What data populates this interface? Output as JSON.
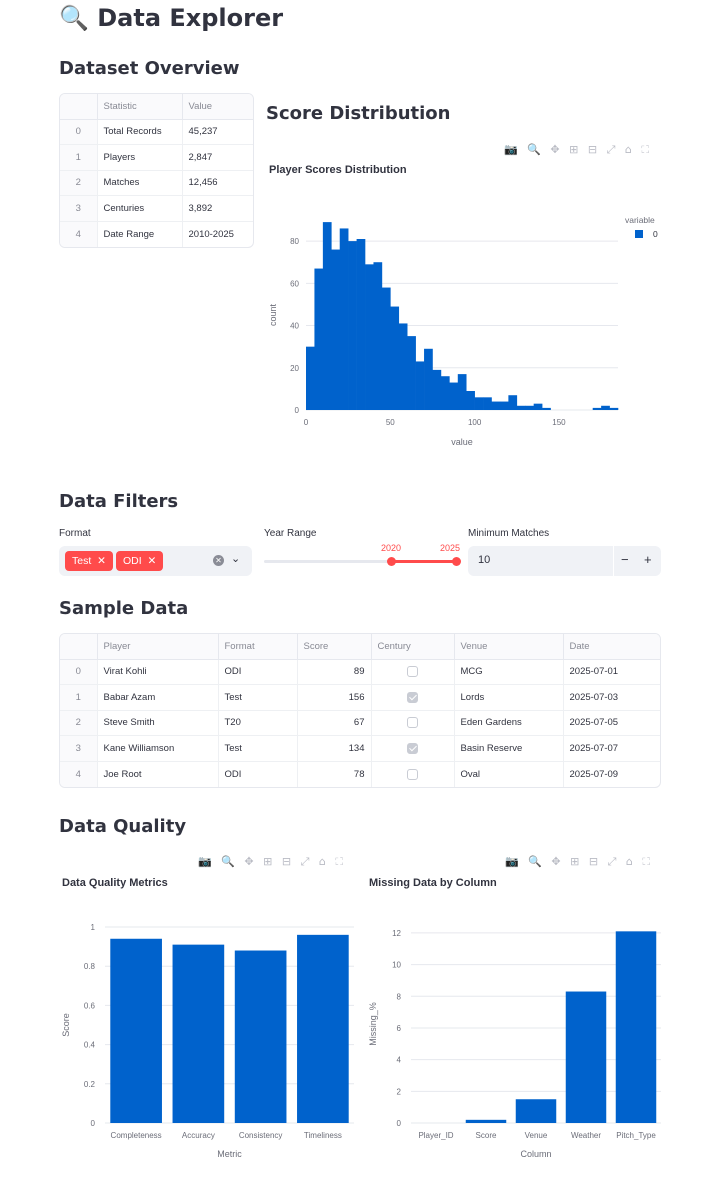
{
  "page": {
    "title": "🔍 Data Explorer",
    "overview_heading": "Dataset Overview",
    "score_heading": "Score Distribution",
    "filters_heading": "Data Filters",
    "sample_heading": "Sample Data",
    "quality_heading": "Data Quality"
  },
  "overview_table": {
    "headers": [
      "",
      "Statistic",
      "Value"
    ],
    "rows": [
      {
        "index": "0",
        "stat": "Total Records",
        "value": "45,237"
      },
      {
        "index": "1",
        "stat": "Players",
        "value": "2,847"
      },
      {
        "index": "2",
        "stat": "Matches",
        "value": "12,456"
      },
      {
        "index": "3",
        "stat": "Centuries",
        "value": "3,892"
      },
      {
        "index": "4",
        "stat": "Date Range",
        "value": "2010-2025"
      }
    ]
  },
  "filters": {
    "format_label": "Format",
    "format_tags": [
      "Test",
      "ODI"
    ],
    "year_label": "Year Range",
    "year_min": "2020",
    "year_max": "2025",
    "matches_label": "Minimum Matches",
    "matches_value": "10",
    "accent": "#ff4b4b"
  },
  "sample_table": {
    "headers": [
      "",
      "Player",
      "Format",
      "Score",
      "Century",
      "Venue",
      "Date"
    ],
    "rows": [
      {
        "index": "0",
        "player": "Virat Kohli",
        "format": "ODI",
        "score": "89",
        "century": false,
        "venue": "MCG",
        "date": "2025-07-01"
      },
      {
        "index": "1",
        "player": "Babar Azam",
        "format": "Test",
        "score": "156",
        "century": true,
        "venue": "Lords",
        "date": "2025-07-03"
      },
      {
        "index": "2",
        "player": "Steve Smith",
        "format": "T20",
        "score": "67",
        "century": false,
        "venue": "Eden Gardens",
        "date": "2025-07-05"
      },
      {
        "index": "3",
        "player": "Kane Williamson",
        "format": "Test",
        "score": "134",
        "century": true,
        "venue": "Basin Reserve",
        "date": "2025-07-07"
      },
      {
        "index": "4",
        "player": "Joe Root",
        "format": "ODI",
        "score": "78",
        "century": false,
        "venue": "Oval",
        "date": "2025-07-09"
      }
    ]
  },
  "toolbar_icons": [
    "camera-icon",
    "zoom-icon",
    "pan-icon",
    "zoom-in-icon",
    "zoom-out-icon",
    "autoscale-icon",
    "home-icon",
    "fullscreen-icon"
  ],
  "chart_data": [
    {
      "type": "bar",
      "title": "Player Scores Distribution",
      "xlabel": "value",
      "ylabel": "count",
      "legend_title": "variable",
      "xlim": [
        0,
        185
      ],
      "ylim": [
        0,
        90
      ],
      "xticks": [
        0,
        50,
        100,
        150
      ],
      "yticks": [
        0,
        20,
        40,
        60,
        80
      ],
      "bin_width": 5,
      "series": [
        {
          "name": "0",
          "color": "#0062cc",
          "x": [
            2.5,
            7.5,
            12.5,
            17.5,
            22.5,
            27.5,
            32.5,
            37.5,
            42.5,
            47.5,
            52.5,
            57.5,
            62.5,
            67.5,
            72.5,
            77.5,
            82.5,
            87.5,
            92.5,
            97.5,
            102.5,
            107.5,
            112.5,
            117.5,
            122.5,
            127.5,
            132.5,
            137.5,
            142.5,
            147.5,
            152.5,
            157.5,
            162.5,
            167.5,
            172.5,
            177.5,
            182.5
          ],
          "values": [
            30,
            67,
            89,
            76,
            86,
            80,
            81,
            69,
            70,
            58,
            49,
            41,
            35,
            23,
            29,
            19,
            16,
            13,
            17,
            9,
            6,
            6,
            4,
            4,
            7,
            2,
            2,
            3,
            1,
            0,
            0,
            0,
            0,
            0,
            1,
            2,
            1
          ]
        }
      ]
    },
    {
      "type": "bar",
      "title": "Data Quality Metrics",
      "xlabel": "Metric",
      "ylabel": "Score",
      "ylim": [
        0,
        1
      ],
      "yticks": [
        "0",
        "0.2",
        "0.4",
        "0.6",
        "0.8",
        "1"
      ],
      "categories": [
        "Completeness",
        "Accuracy",
        "Consistency",
        "Timeliness"
      ],
      "values": [
        0.94,
        0.91,
        0.88,
        0.96
      ],
      "color": "#0062cc"
    },
    {
      "type": "bar",
      "title": "Missing Data by Column",
      "xlabel": "Column",
      "ylabel": "Missing_%",
      "ylim": [
        0,
        12.5
      ],
      "yticks": [
        "0",
        "2",
        "4",
        "6",
        "8",
        "10",
        "12"
      ],
      "categories": [
        "Player_ID",
        "Score",
        "Venue",
        "Weather",
        "Pitch_Type"
      ],
      "values": [
        0,
        0.2,
        1.5,
        8.3,
        12.1
      ],
      "color": "#0062cc"
    }
  ]
}
